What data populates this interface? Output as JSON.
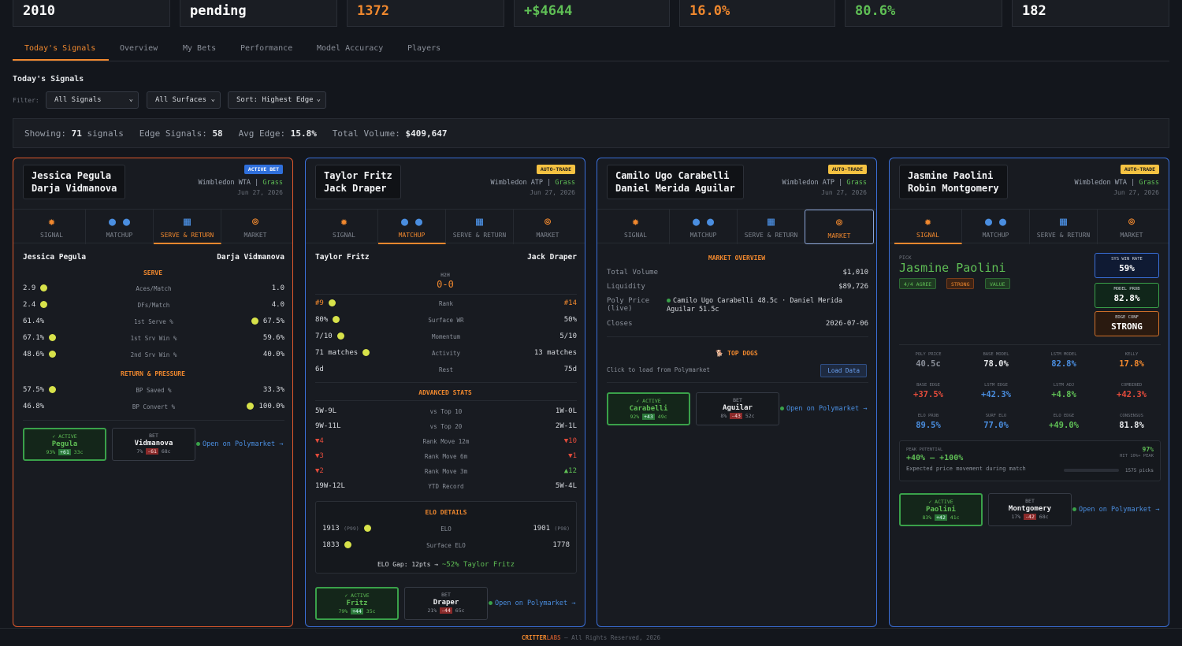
{
  "stats": [
    "2010",
    "pending",
    "1372",
    "+$4644",
    "16.0%",
    "80.6%",
    "182"
  ],
  "tabs": [
    "Today's Signals",
    "Overview",
    "My Bets",
    "Performance",
    "Model Accuracy",
    "Players"
  ],
  "section_title": "Today's Signals",
  "filter": {
    "label": "Filter:",
    "signals": "All Signals",
    "surfaces": "All Surfaces",
    "sort": "Sort: Highest Edge"
  },
  "summary": {
    "showing_label": "Showing:",
    "showing": "71",
    "signals_word": "signals",
    "edge_label": "Edge Signals:",
    "edge": "58",
    "avg_label": "Avg Edge:",
    "avg": "15.8%",
    "vol_label": "Total Volume:",
    "vol": "$409,647"
  },
  "card_tabs": [
    "SIGNAL",
    "MATCHUP",
    "SERVE & RETURN",
    "MARKET"
  ],
  "open_poly": "Open on Polymarket →",
  "active_label": "✓ ACTIVE",
  "bet_label": "BET",
  "cards": [
    {
      "p1": "Jessica Pegula",
      "p2": "Darja Vidmanova",
      "badge": "ACTIVE BET",
      "tour": "Wimbledon WTA",
      "surface": "Grass",
      "date": "Jun 27, 2026",
      "serve_title": "SERVE",
      "serve_rows": [
        {
          "l": "2.9",
          "m": "Aces/Match",
          "r": "1.0"
        },
        {
          "l": "2.4",
          "m": "DFs/Match",
          "r": "4.0"
        },
        {
          "l": "61.4%",
          "m": "1st Serve %",
          "r": "67.5%"
        },
        {
          "l": "67.1%",
          "m": "1st Srv Win %",
          "r": "59.6%"
        },
        {
          "l": "48.6%",
          "m": "2nd Srv Win %",
          "r": "40.0%"
        }
      ],
      "return_title": "RETURN & PRESSURE",
      "return_rows": [
        {
          "l": "57.5%",
          "m": "BP Saved %",
          "r": "33.3%"
        },
        {
          "l": "46.8%",
          "m": "BP Convert %",
          "r": "100.0%"
        }
      ],
      "active": {
        "name": "Pegula",
        "pct": "93%",
        "chg": "+61",
        "price": "33c"
      },
      "bet": {
        "name": "Vidmanova",
        "pct": "7%",
        "chg": "-61",
        "price": "68c"
      }
    },
    {
      "p1": "Taylor Fritz",
      "p2": "Jack Draper",
      "badge": "AUTO-TRADE",
      "tour": "Wimbledon ATP",
      "surface": "Grass",
      "date": "Jun 27, 2026",
      "h2h_label": "H2H",
      "h2h": "0-0",
      "rows": [
        {
          "l": "#9",
          "m": "Rank",
          "r": "#14"
        },
        {
          "l": "80%",
          "m": "Surface WR",
          "r": "50%"
        },
        {
          "l": "7/10",
          "m": "Momentum",
          "r": "5/10"
        },
        {
          "l": "71 matches",
          "m": "Activity",
          "r": "13 matches"
        },
        {
          "l": "6d",
          "m": "Rest",
          "r": "75d"
        }
      ],
      "adv_title": "ADVANCED STATS",
      "adv_rows": [
        {
          "l": "5W-9L",
          "m": "vs Top 10",
          "r": "1W-0L"
        },
        {
          "l": "9W-11L",
          "m": "vs Top 20",
          "r": "2W-1L"
        },
        {
          "l": "▼4",
          "m": "Rank Move 12m",
          "r": "▼10"
        },
        {
          "l": "▼3",
          "m": "Rank Move 6m",
          "r": "▼1"
        },
        {
          "l": "▼2",
          "m": "Rank Move 3m",
          "r": "▲12"
        },
        {
          "l": "19W-12L",
          "m": "YTD Record",
          "r": "5W-4L"
        }
      ],
      "elo_title": "ELO DETAILS",
      "elo_rows": [
        {
          "l": "1913",
          "lsub": "(P99)",
          "m": "ELO",
          "r": "1901",
          "rsub": "(P98)"
        },
        {
          "l": "1833",
          "lsub": "",
          "m": "Surface ELO",
          "r": "1778",
          "rsub": ""
        }
      ],
      "elo_gap_label": "ELO Gap: 12pts →",
      "elo_gap_val": "~52% Taylor Fritz",
      "active": {
        "name": "Fritz",
        "pct": "79%",
        "chg": "+44",
        "price": "35c"
      },
      "bet": {
        "name": "Draper",
        "pct": "21%",
        "chg": "-44",
        "price": "65c"
      }
    },
    {
      "p1": "Camilo Ugo Carabelli",
      "p2": "Daniel Merida Aguilar",
      "badge": "AUTO-TRADE",
      "tour": "Wimbledon ATP",
      "surface": "Grass",
      "date": "Jun 27, 2026",
      "mkt_title": "MARKET OVERVIEW",
      "mkt": {
        "vol_label": "Total Volume",
        "vol": "$1,010",
        "liq_label": "Liquidity",
        "liq": "$89,726",
        "poly_label": "Poly Price",
        "poly_sub": "(live)",
        "poly_val": "Camilo Ugo Carabelli 48.5c · Daniel Merida Aguilar 51.5c",
        "closes_label": "Closes",
        "closes": "2026-07-06"
      },
      "topdogs": "TOP DOGS",
      "click_load": "Click to load from Polymarket",
      "load_btn": "Load Data",
      "active": {
        "name": "Carabelli",
        "pct": "92%",
        "chg": "+43",
        "price": "49c"
      },
      "bet": {
        "name": "Aguilar",
        "pct": "8%",
        "chg": "-43",
        "price": "52c"
      }
    },
    {
      "p1": "Jasmine Paolini",
      "p2": "Robin Montgomery",
      "badge": "AUTO-TRADE",
      "tour": "Wimbledon WTA",
      "surface": "Grass",
      "date": "Jun 27, 2026",
      "pick_label": "PICK",
      "pick": "Jasmine Paolini",
      "tags": [
        "4/4 AGREE",
        "STRONG",
        "VALUE"
      ],
      "metrics": [
        {
          "l": "SYS WIN RATE",
          "v": "59%"
        },
        {
          "l": "MODEL PROB",
          "v": "82.8%"
        },
        {
          "l": "EDGE CONF",
          "v": "STRONG"
        }
      ],
      "grid": [
        {
          "l": "POLY PRICE",
          "v": "40.5c",
          "c": "#8a8f99"
        },
        {
          "l": "BASE MODEL",
          "v": "78.0%",
          "c": "#e6e8eb"
        },
        {
          "l": "LSTM MODEL",
          "v": "82.8%",
          "c": "#4a8ee0"
        },
        {
          "l": "KELLY",
          "v": "17.8%",
          "c": "#f0882e"
        },
        {
          "l": "BASE EDGE",
          "v": "+37.5%",
          "c": "#e24b3b"
        },
        {
          "l": "LSTM EDGE",
          "v": "+42.3%",
          "c": "#4a8ee0"
        },
        {
          "l": "LSTM ADJ",
          "v": "+4.8%",
          "c": "#5fbf55"
        },
        {
          "l": "COMBINED",
          "v": "+42.3%",
          "c": "#e24b3b"
        },
        {
          "l": "ELO PROB",
          "v": "89.5%",
          "c": "#4a8ee0"
        },
        {
          "l": "SURF ELO",
          "v": "77.0%",
          "c": "#4a8ee0"
        },
        {
          "l": "ELO EDGE",
          "v": "+49.0%",
          "c": "#5fbf55"
        },
        {
          "l": "CONSENSUS",
          "v": "81.8%",
          "c": "#e6e8eb"
        }
      ],
      "peak": {
        "label": "PEAK POTENTIAL",
        "range": "+40% — +100%",
        "desc": "Expected price movement during match",
        "pct": "97%",
        "pct_label": "HIT 10%+ PEAK",
        "picks": "1575 picks"
      },
      "active": {
        "name": "Paolini",
        "pct": "83%",
        "chg": "+42",
        "price": "41c"
      },
      "bet": {
        "name": "Montgomery",
        "pct": "17%",
        "chg": "-42",
        "price": "68c"
      }
    }
  ],
  "footer": {
    "brand1": "CRITTER",
    "brand2": "LABS",
    "rest": "— All Rights Reserved, 2026"
  }
}
